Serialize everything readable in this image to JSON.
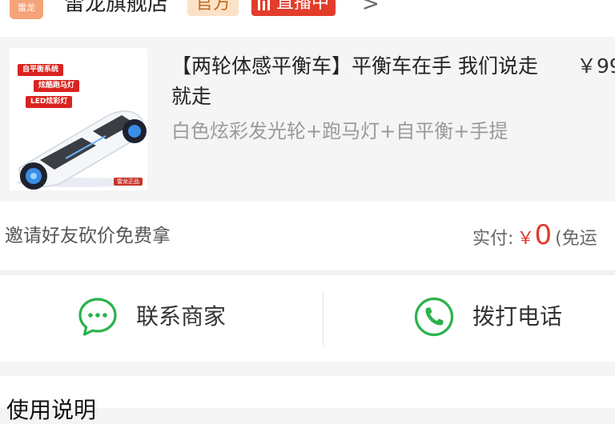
{
  "store": {
    "logo_text": "雷龙",
    "name": "雷龙旗舰店",
    "official_badge": "官方",
    "live_badge": "直播中",
    "chevron": ">"
  },
  "product": {
    "image_tags": [
      "自平衡系统",
      "炫酷跑马灯",
      "LED炫彩灯"
    ],
    "image_corner": "雷龙正品",
    "title": "【两轮体感平衡车】平衡车在手 我们说走就走",
    "price": "￥99",
    "spec": "白色炫彩发光轮+跑马灯+自平衡+手提"
  },
  "invite": {
    "text": "邀请好友砍价免费拿",
    "paid_label": "实付:",
    "currency": "￥",
    "amount": "0",
    "note": "(免运"
  },
  "actions": {
    "contact_label": "联系商家",
    "call_label": "拨打电话"
  },
  "usage": {
    "title": "使用说明"
  },
  "colors": {
    "accent_red": "#e2382b",
    "wechat_green": "#2bb24c",
    "official_bg": "#fbe2c7"
  },
  "icons": {
    "contact": "chat-bubble-icon",
    "call": "phone-icon"
  }
}
